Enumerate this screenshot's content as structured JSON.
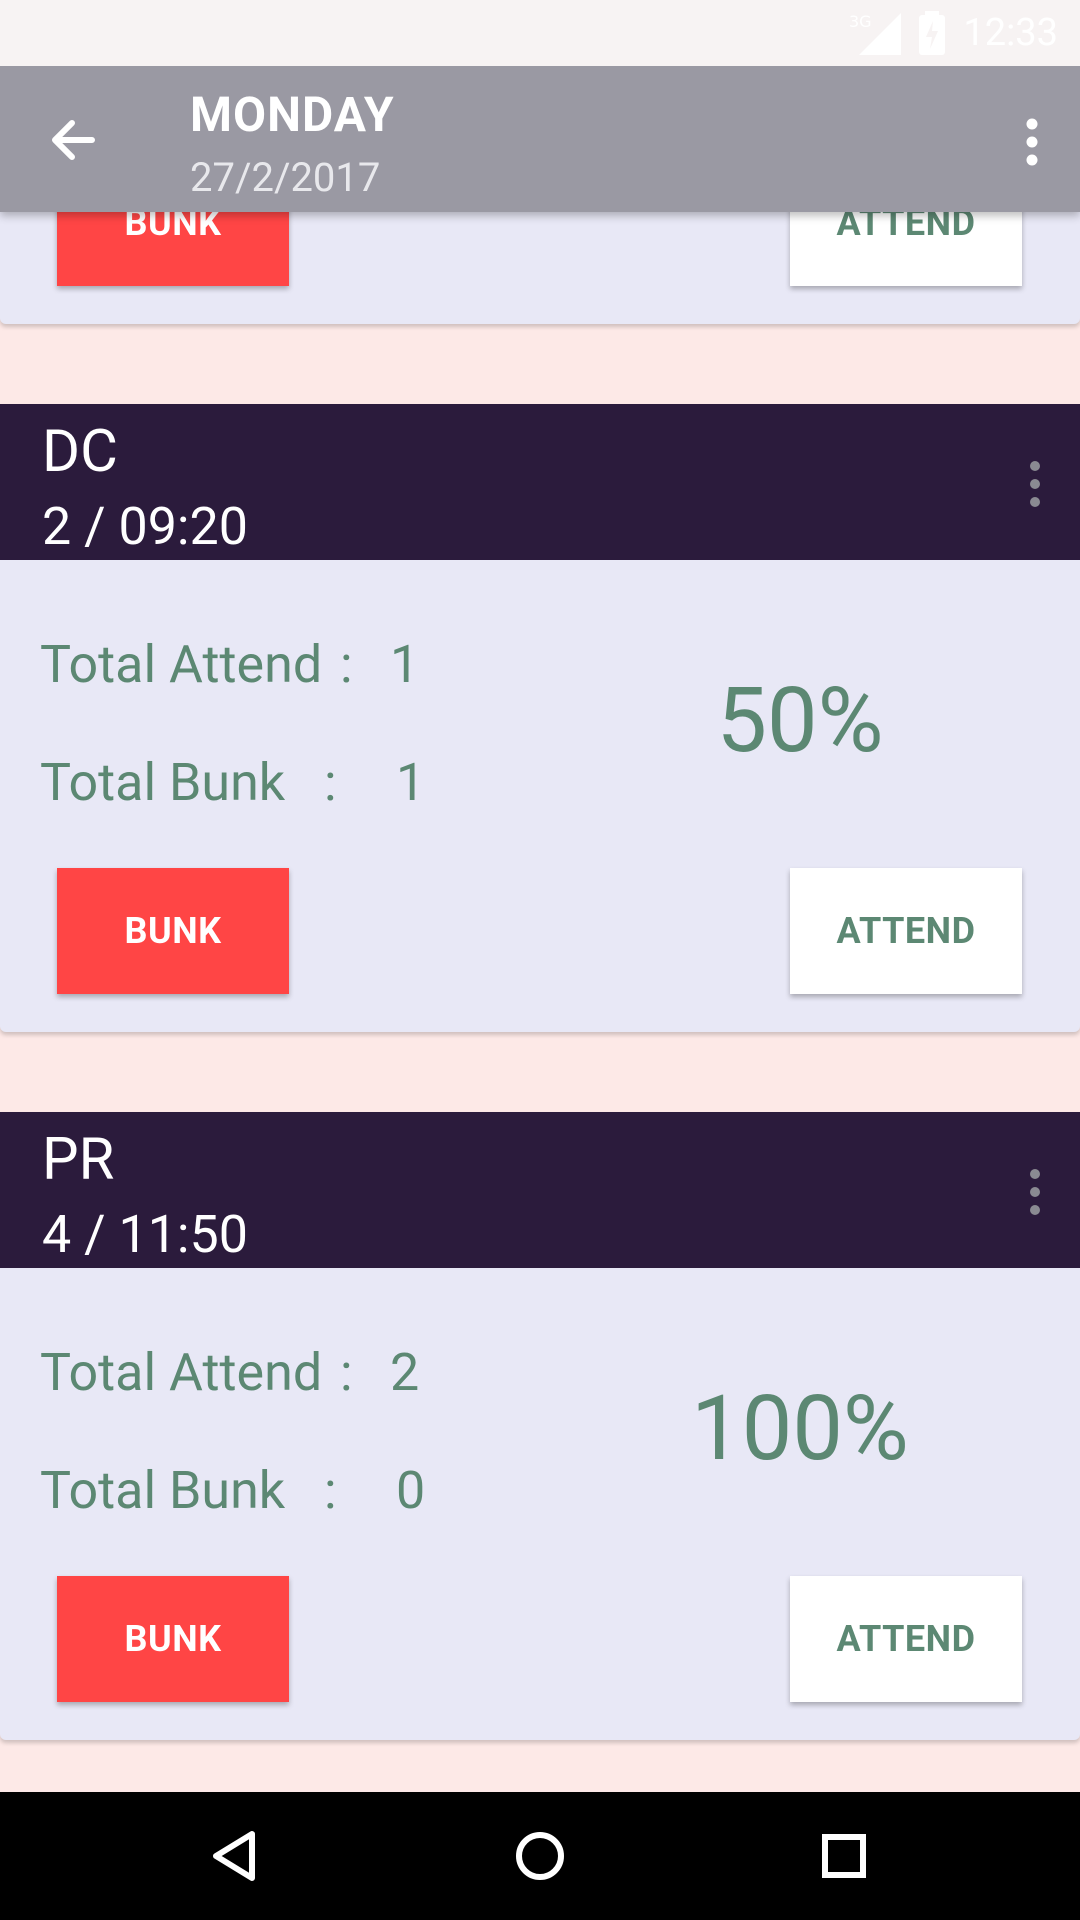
{
  "status_bar": {
    "network": "3G",
    "time": "12:33"
  },
  "app_bar": {
    "title": "MONDAY",
    "subtitle": "27/2/2017",
    "back_icon": "arrow-back-icon",
    "menu_icon": "more-vert-icon"
  },
  "cards": [
    {
      "bunk_label": "BUNK",
      "attend_label": "ATTEND"
    },
    {
      "subject": "DC",
      "slot": "2 / 09:20",
      "attend_label_text": "Total Attend",
      "bunk_label_text": "Total Bunk",
      "colon": ":",
      "total_attend": "1",
      "total_bunk": "1",
      "percent": "50%",
      "bunk_label": "BUNK",
      "attend_label": "ATTEND"
    },
    {
      "subject": "PR",
      "slot": "4 / 11:50",
      "attend_label_text": "Total Attend",
      "bunk_label_text": "Total Bunk",
      "colon": ":",
      "total_attend": "2",
      "total_bunk": "0",
      "percent": "100%",
      "bunk_label": "BUNK",
      "attend_label": "ATTEND"
    }
  ],
  "nav_bar": {
    "back_icon": "nav-back-icon",
    "home_icon": "nav-home-icon",
    "recents_icon": "nav-recents-icon"
  },
  "colors": {
    "app_bar": "#9A99A3",
    "card_header": "#2B1B3C",
    "card_body": "#E8E8F6",
    "page_background": "#FDE9E7",
    "bunk_button": "#FF4545",
    "accent_text": "#5C8873"
  }
}
